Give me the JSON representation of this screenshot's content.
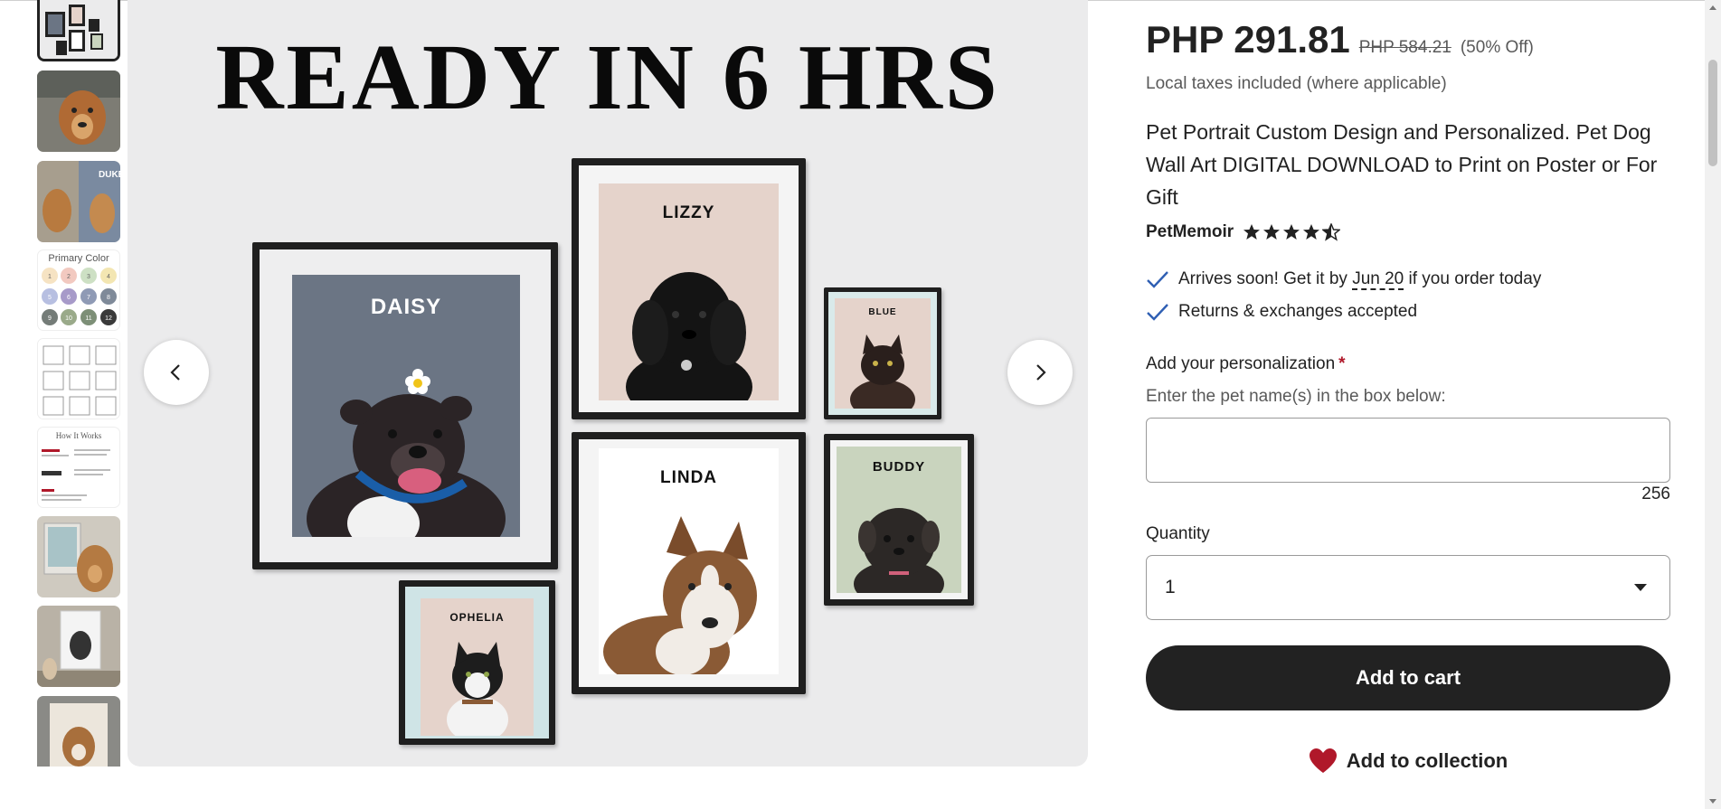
{
  "main_image": {
    "headline": "READY IN 6 HRS",
    "pets": [
      "DAISY",
      "LIZZY",
      "BLUE",
      "LINDA",
      "BUDDY",
      "OPHELIA"
    ]
  },
  "thumbnails": {
    "primary_color_label": "Primary Color",
    "swatch_numbers": [
      "1",
      "2",
      "3",
      "4",
      "5",
      "6",
      "7",
      "8",
      "9",
      "10",
      "11",
      "12"
    ],
    "how_it_works_label": "How It Works",
    "pet_label_duke": "DUKE"
  },
  "product": {
    "price": "PHP 291.81",
    "old_price": "PHP 584.21",
    "discount": "(50% Off)",
    "taxes_note": "Local taxes included (where applicable)",
    "title": "Pet Portrait Custom Design and Personalized. Pet Dog Wall Art DIGITAL DOWNLOAD to Print on Poster or For Gift",
    "seller": "PetMemoir",
    "rating": 4.5,
    "arrival_prefix": "Arrives soon! Get it by ",
    "arrival_date": "Jun 20",
    "arrival_suffix": " if you order today",
    "returns": "Returns & exchanges accepted",
    "personalization_label": "Add your personalization",
    "personalization_hint": "Enter the pet name(s) in the box below:",
    "char_counter": "256",
    "quantity_label": "Quantity",
    "quantity_value": "1",
    "add_to_cart": "Add to cart",
    "add_to_collection": "Add to collection"
  },
  "colors": {
    "accent_dark": "#222222",
    "required_star": "#b0182a",
    "heart": "#b0182a",
    "check": "#2f5fb3"
  }
}
